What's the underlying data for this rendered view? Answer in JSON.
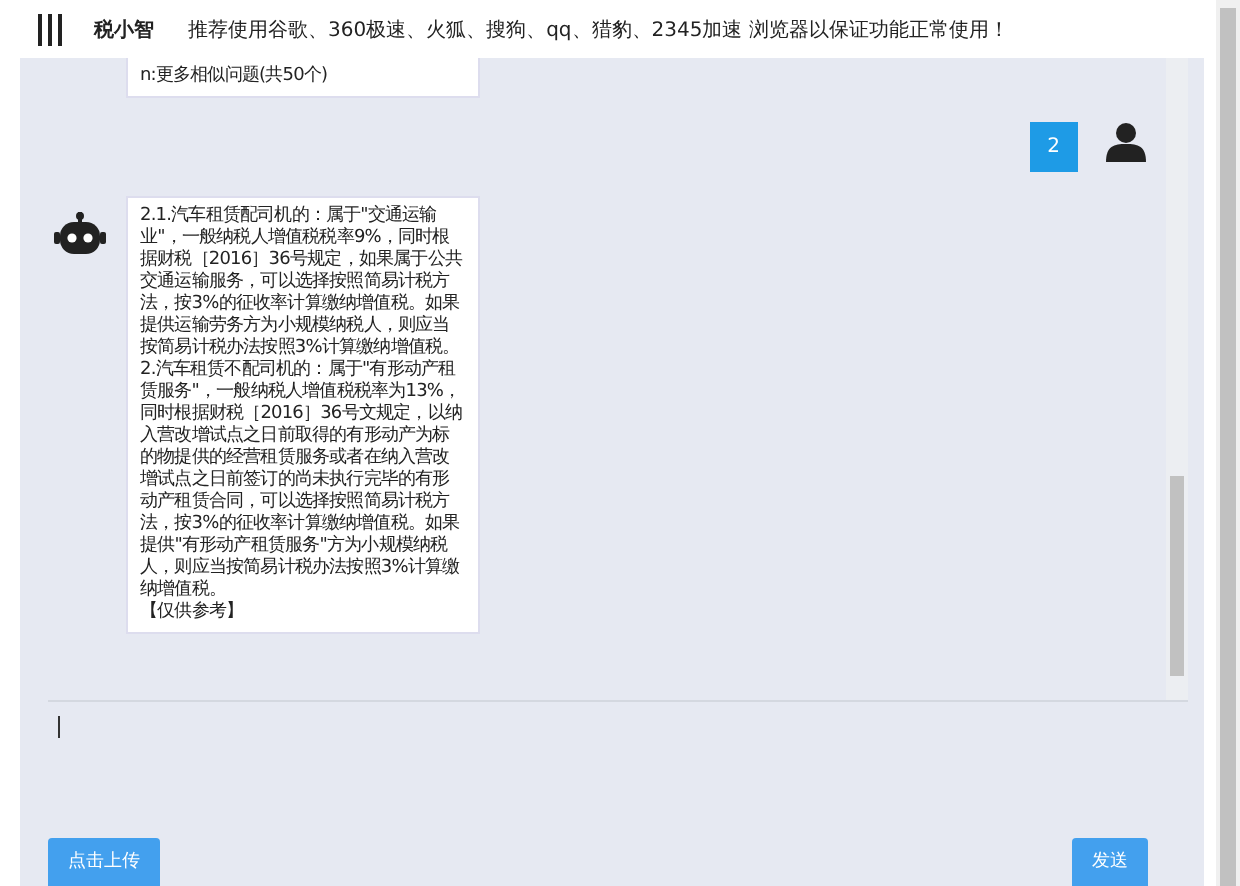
{
  "header": {
    "app_name": "税小智",
    "notice": "推荐使用谷歌、360极速、火狐、搜狗、qq、猎豹、2345加速 浏览器以保证功能正常使用！"
  },
  "messages": [
    {
      "kind": "bot",
      "paragraphs": [
        "n:更多相似问题(共50个)"
      ]
    },
    {
      "kind": "user",
      "paragraphs": [
        "2"
      ]
    },
    {
      "kind": "bot",
      "paragraphs": [
        "2.1.汽车租赁配司机的：属于\"交通运输业\"，一般纳税人增值税税率9%，同时根据财税［2016］36号规定，如果属于公共交通运输服务，可以选择按照简易计税方法，按3%的征收率计算缴纳增值税。如果提供运输劳务方为小规模纳税人，则应当按简易计税办法按照3%计算缴纳增值税。",
        "2.汽车租赁不配司机的：属于\"有形动产租赁服务\"，一般纳税人增值税税率为13%，同时根据财税［2016］36号文规定，以纳入营改增试点之日前取得的有形动产为标的物提供的经营租赁服务或者在纳入营改增试点之日前签订的尚未执行完毕的有形动产租赁合同，可以选择按照简易计税方法，按3%的征收率计算缴纳增值税。如果提供\"有形动产租赁服务\"方为小规模纳税人，则应当按简易计税办法按照3%计算缴纳增值税。",
        "【仅供参考】"
      ]
    }
  ],
  "buttons": {
    "upload": "点击上传",
    "send": "发送"
  }
}
